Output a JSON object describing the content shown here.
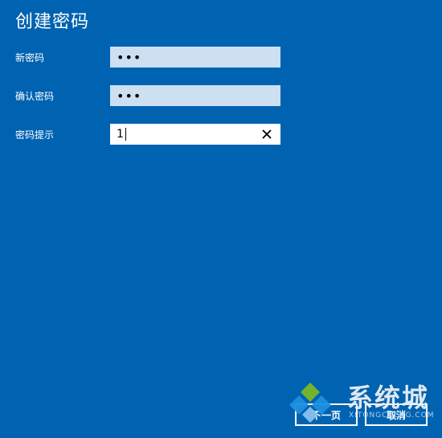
{
  "dialog": {
    "title": "创建密码"
  },
  "fields": {
    "new_password": {
      "label": "新密码",
      "value": "•••"
    },
    "confirm_password": {
      "label": "确认密码",
      "value": "•••"
    },
    "password_hint": {
      "label": "密码提示",
      "value": "1"
    }
  },
  "icons": {
    "clear": "close-icon"
  },
  "buttons": {
    "next_label": "下一页",
    "cancel_label": "取消"
  },
  "watermark": {
    "brand": "系统城",
    "url": "XITONGCHENG.COM"
  },
  "colors": {
    "background": "#0063b1",
    "password_field_bg": "#cce0f1",
    "hint_field_bg": "#ffffff",
    "text": "#ffffff",
    "watermark_green": "#7ab829",
    "watermark_blue": "#1e90e0"
  }
}
